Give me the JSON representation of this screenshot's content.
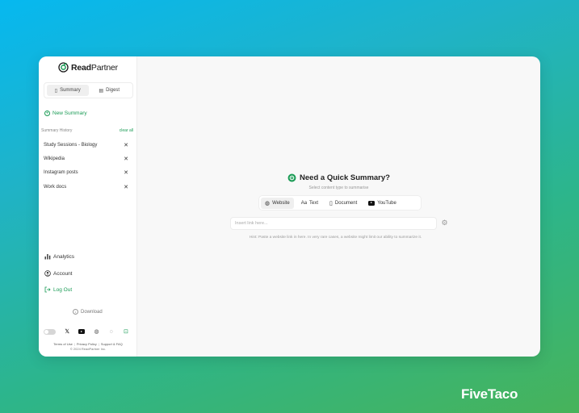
{
  "app": {
    "logo_bold": "Read",
    "logo_light": "Partner",
    "accent_color": "#1a9b55"
  },
  "sidebar": {
    "modes": [
      {
        "label": "Summary",
        "icon": "phone-icon",
        "active": true
      },
      {
        "label": "Digest",
        "icon": "newspaper-icon",
        "active": false
      }
    ],
    "new_summary_label": "New Summary",
    "history_title": "Summary History",
    "clear_all_label": "clear all",
    "history": [
      {
        "label": "Study Sessions - Biology"
      },
      {
        "label": "Wikipedia"
      },
      {
        "label": "Instagram posts"
      },
      {
        "label": "Work docs"
      }
    ],
    "nav": {
      "analytics": "Analytics",
      "account": "Account",
      "logout": "Log Out"
    },
    "download_label": "Download",
    "footer": {
      "terms": "Terms of Use",
      "privacy": "Privacy Policy",
      "support": "Support & FAQ",
      "copyright": "© 2024 ReadPartner Inc."
    }
  },
  "main": {
    "title": "Need a Quick Summary?",
    "subtitle": "Select content type to summarise",
    "content_types": [
      {
        "label": "Website",
        "icon": "globe-icon",
        "active": true
      },
      {
        "label": "Text",
        "icon": "text-icon",
        "active": false
      },
      {
        "label": "Document",
        "icon": "document-icon",
        "active": false
      },
      {
        "label": "YouTube",
        "icon": "youtube-icon",
        "active": false
      }
    ],
    "link_input": {
      "value": "",
      "placeholder": "Insert link here..."
    },
    "hint": "Hint: Paste a website link in here. In very rare cases, a website might limit our ability to summarize it."
  },
  "watermark": "FiveTaco"
}
